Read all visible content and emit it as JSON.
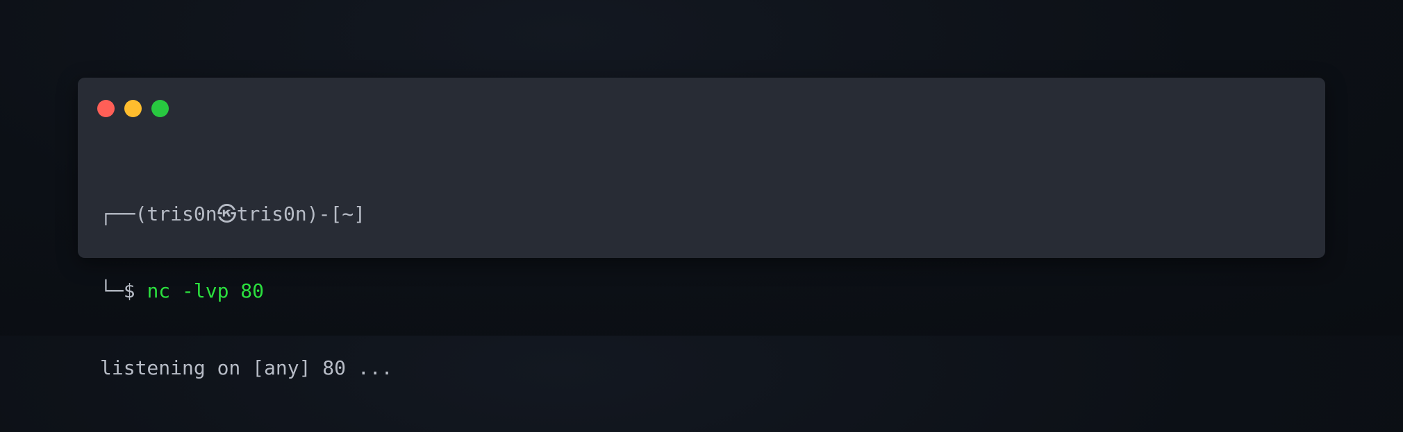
{
  "window": {
    "controls": [
      {
        "name": "close",
        "color": "#ff5f57"
      },
      {
        "name": "minimize",
        "color": "#ffbd2e"
      },
      {
        "name": "maximize",
        "color": "#28c840"
      }
    ]
  },
  "terminal": {
    "prompt_line": {
      "corner": "┌──",
      "user_host": "(tris0n㉿tris0n)-[~]"
    },
    "command_line": {
      "corner": "└─$",
      "command": "nc -lvp 80"
    },
    "output_line": "listening on [any] 80 ..."
  },
  "colors": {
    "background": "#0c1016",
    "window": "#282c35",
    "text": "#b7bcc6",
    "command": "#2be03e"
  }
}
